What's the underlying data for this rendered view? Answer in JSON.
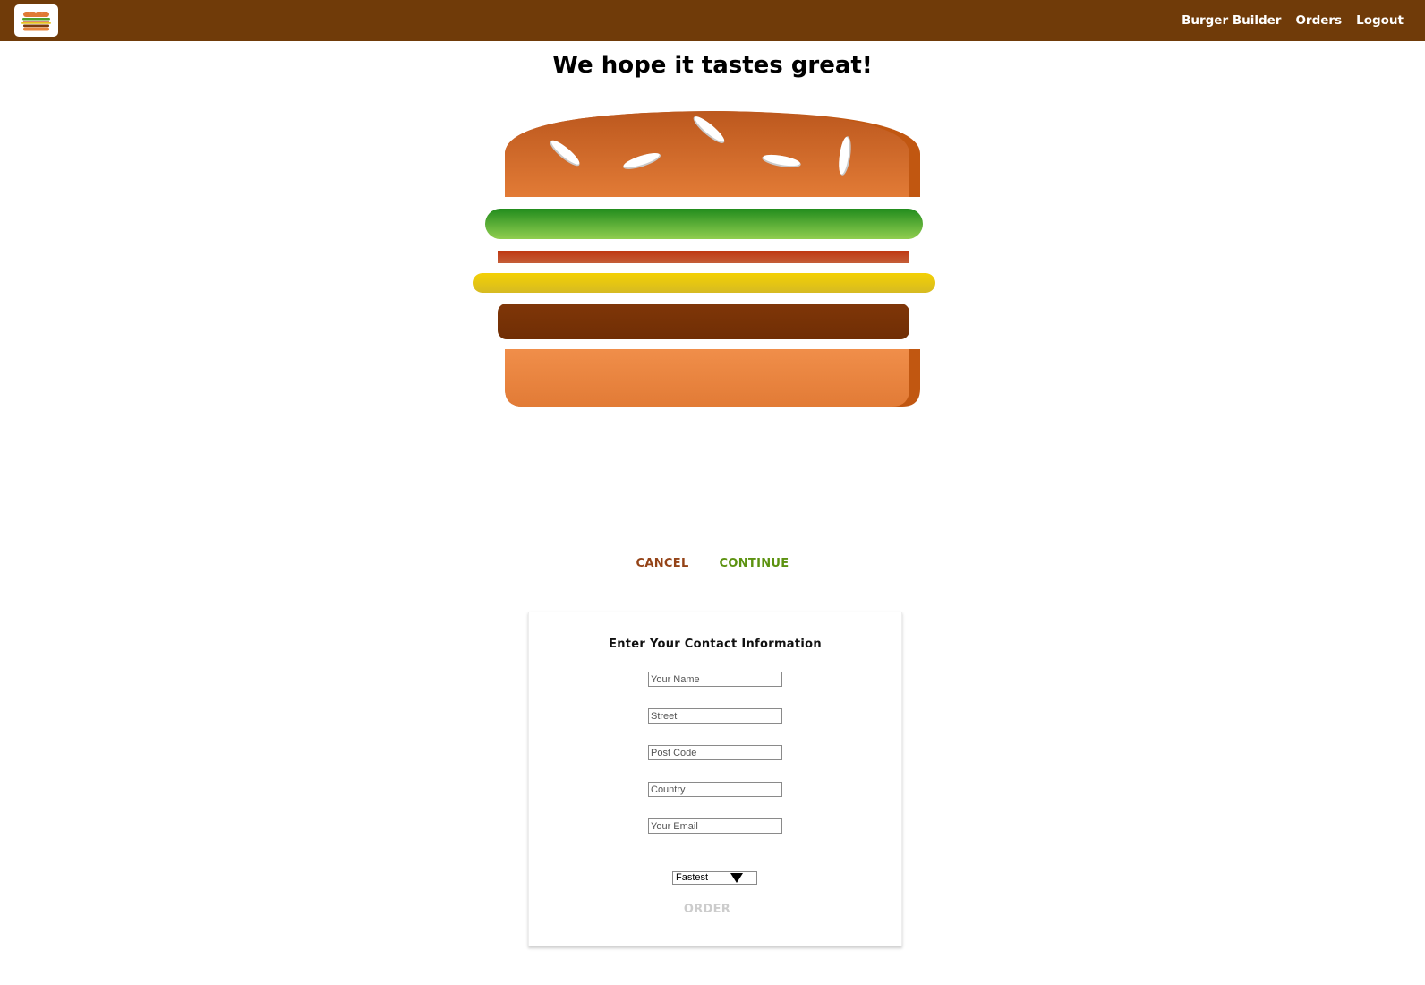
{
  "header": {
    "logo_name": "burger-logo",
    "nav": [
      {
        "label": "Burger Builder"
      },
      {
        "label": "Orders"
      },
      {
        "label": "Logout"
      }
    ]
  },
  "main": {
    "title": "We hope it tastes great!",
    "burger_layers": [
      "bread-top",
      "salad",
      "bacon",
      "cheese",
      "meat",
      "bread-bottom"
    ],
    "cancel_label": "CANCEL",
    "continue_label": "CONTINUE"
  },
  "contact": {
    "heading": "Enter Your Contact Information",
    "fields": [
      {
        "placeholder": "Your Name",
        "value": ""
      },
      {
        "placeholder": "Street",
        "value": ""
      },
      {
        "placeholder": "Post Code",
        "value": ""
      },
      {
        "placeholder": "Country",
        "value": ""
      },
      {
        "placeholder": "Your Email",
        "value": ""
      }
    ],
    "delivery_selected": "Fastest",
    "order_label": "ORDER"
  },
  "colors": {
    "toolbar": "#703B09",
    "cancel": "#944317",
    "continue": "#5C9210",
    "order_disabled": "#cccccc"
  }
}
